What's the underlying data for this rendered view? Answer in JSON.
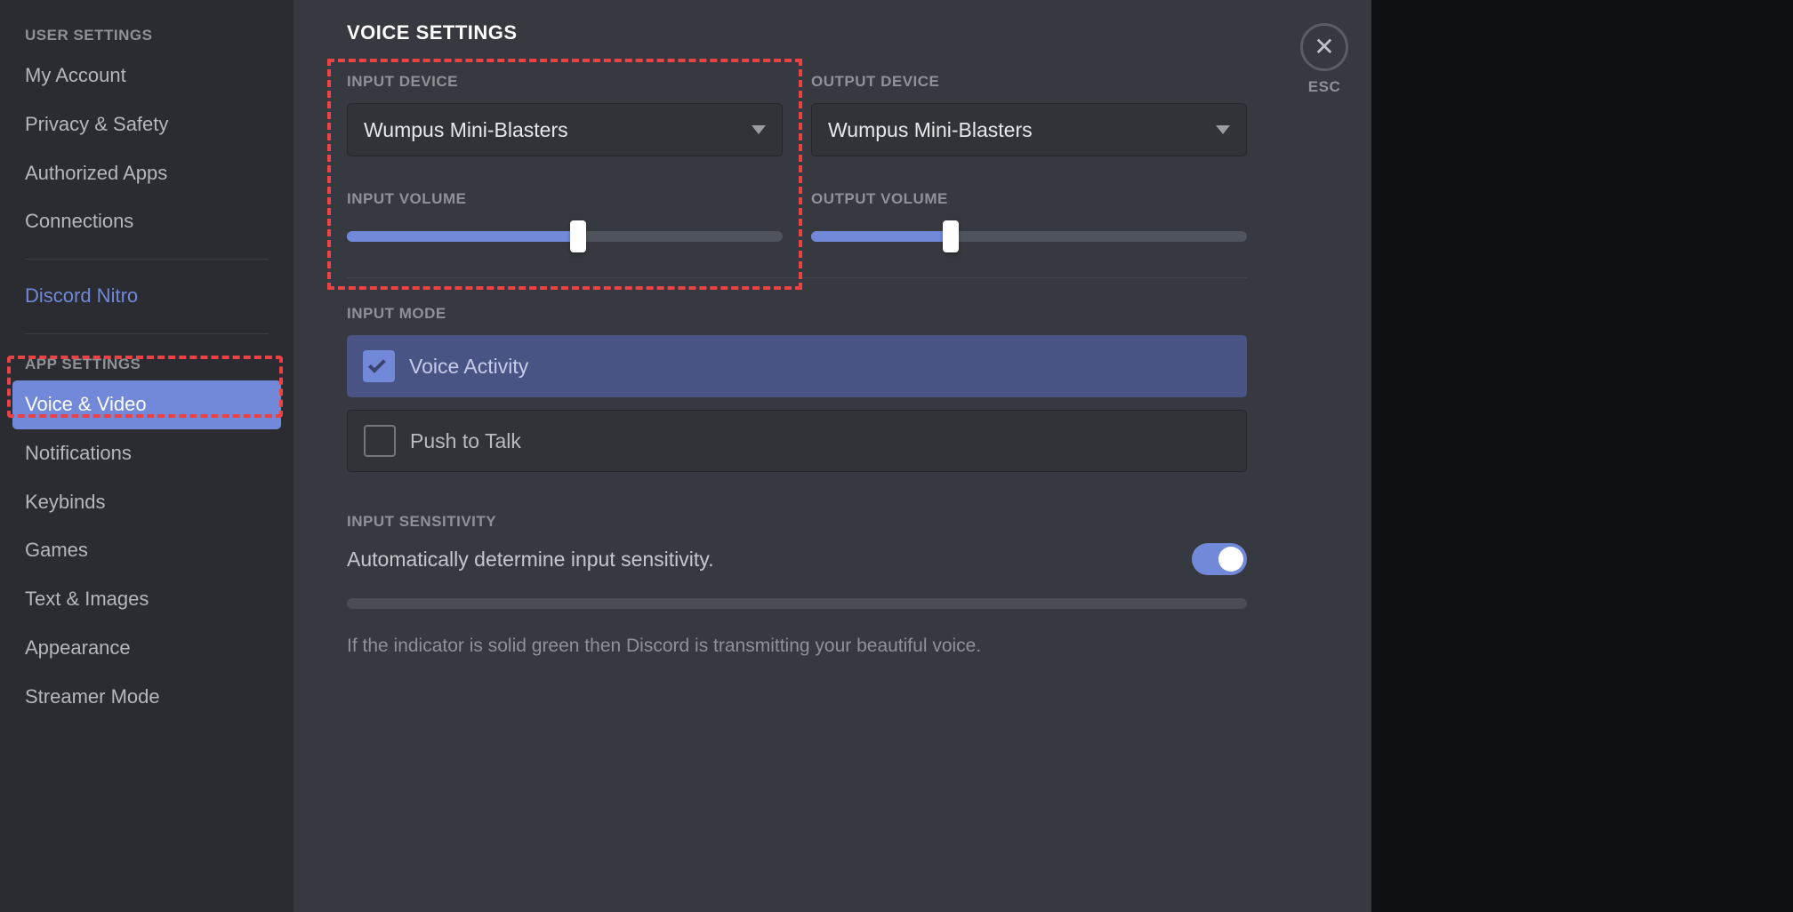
{
  "sidebar": {
    "heading_user": "USER SETTINGS",
    "heading_app": "APP SETTINGS",
    "items_user": [
      {
        "label": "My Account"
      },
      {
        "label": "Privacy & Safety"
      },
      {
        "label": "Authorized Apps"
      },
      {
        "label": "Connections"
      }
    ],
    "nitro": "Discord Nitro",
    "items_app": [
      {
        "label": "Voice & Video",
        "selected": true
      },
      {
        "label": "Notifications"
      },
      {
        "label": "Keybinds"
      },
      {
        "label": "Games"
      },
      {
        "label": "Text & Images"
      },
      {
        "label": "Appearance"
      },
      {
        "label": "Streamer Mode"
      }
    ]
  },
  "page": {
    "title": "VOICE SETTINGS",
    "esc": "ESC"
  },
  "voice": {
    "input_device_label": "INPUT DEVICE",
    "input_device_value": "Wumpus Mini-Blasters",
    "output_device_label": "OUTPUT DEVICE",
    "output_device_value": "Wumpus Mini-Blasters",
    "input_volume_label": "INPUT VOLUME",
    "input_volume_pct": 53,
    "output_volume_label": "OUTPUT VOLUME",
    "output_volume_pct": 32,
    "input_mode_label": "INPUT MODE",
    "mode_voice_activity": "Voice Activity",
    "mode_push_to_talk": "Push to Talk",
    "input_sensitivity_label": "INPUT SENSITIVITY",
    "auto_sensitivity_desc": "Automatically determine input sensitivity.",
    "auto_sensitivity_on": true,
    "hint": "If the indicator is solid green then Discord is transmitting your beautiful voice."
  },
  "colors": {
    "accent": "#7289da",
    "danger": "#ed4245"
  }
}
